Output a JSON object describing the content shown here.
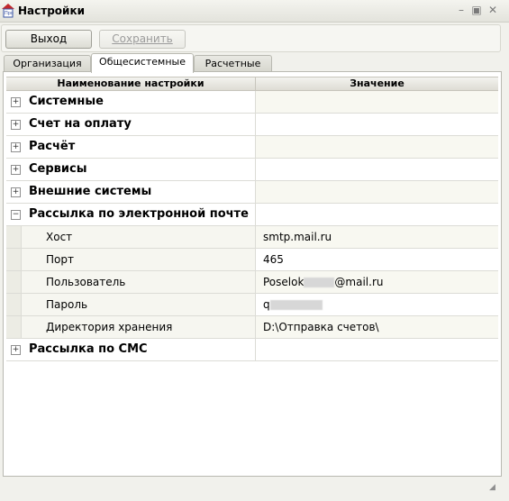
{
  "window": {
    "title": "Настройки",
    "icon": "app-house-icon"
  },
  "toolbar": {
    "exit_label": "Выход",
    "save_label": "Сохранить"
  },
  "tabs": [
    {
      "label": "Организация",
      "active": false
    },
    {
      "label": "Общесистемные",
      "active": true
    },
    {
      "label": "Расчетные",
      "active": false
    }
  ],
  "grid": {
    "headers": {
      "name": "Наименование настройки",
      "value": "Значение"
    },
    "groups": [
      {
        "label": "Системные",
        "expanded": false
      },
      {
        "label": "Счет на оплату",
        "expanded": false
      },
      {
        "label": "Расчёт",
        "expanded": false
      },
      {
        "label": "Сервисы",
        "expanded": false
      },
      {
        "label": "Внешние системы",
        "expanded": false
      },
      {
        "label": "Рассылка по электронной почте",
        "expanded": true
      },
      {
        "label": "Рассылка по СМС",
        "expanded": false
      }
    ],
    "email_settings": [
      {
        "name": "Хост",
        "value": "smtp.mail.ru"
      },
      {
        "name": "Порт",
        "value": "465"
      },
      {
        "name": "Пользователь",
        "value_prefix": "Poselok",
        "value_suffix": "@mail.ru"
      },
      {
        "name": "Пароль",
        "value_prefix": "q"
      },
      {
        "name": "Директория хранения",
        "value": "D:\\Отправка счетов\\"
      }
    ]
  }
}
